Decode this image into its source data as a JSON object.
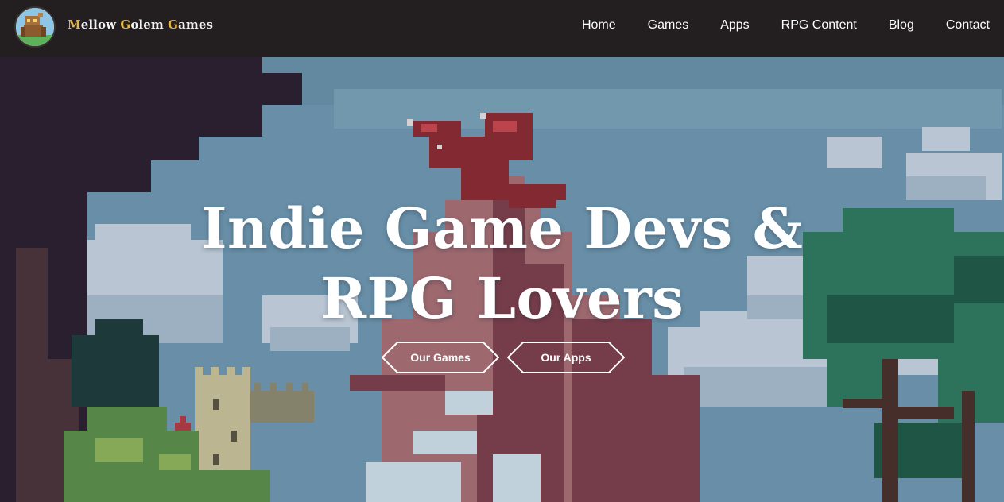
{
  "brand": {
    "name_parts": [
      {
        "cap": "M",
        "rest": "ellow "
      },
      {
        "cap": "G",
        "rest": "olem "
      },
      {
        "cap": "G",
        "rest": "ames"
      }
    ],
    "logo_icon": "golem-logo-icon"
  },
  "nav": {
    "items": [
      {
        "label": "Home"
      },
      {
        "label": "Games"
      },
      {
        "label": "Apps"
      },
      {
        "label": "RPG Content"
      },
      {
        "label": "Blog"
      },
      {
        "label": "Contact"
      }
    ]
  },
  "hero": {
    "title_line1": "Indie Game Devs &",
    "title_line2": "RPG Lovers",
    "buttons": [
      {
        "label": "Our Games"
      },
      {
        "label": "Our Apps"
      }
    ],
    "background": "pixel-art-dragon-landscape"
  },
  "colors": {
    "navbar_bg": "#231f20",
    "brand_accent": "#e2b64a",
    "sky": "#6f98b0",
    "dragon": "#8c2a30",
    "tree_green": "#2f7a5e"
  }
}
